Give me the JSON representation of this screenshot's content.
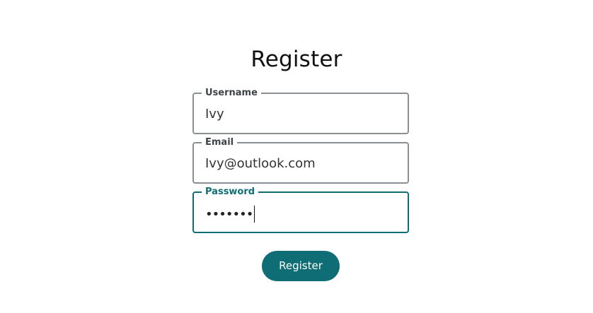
{
  "page": {
    "title": "Register"
  },
  "fields": {
    "username": {
      "label": "Username",
      "value": "Ivy"
    },
    "email": {
      "label": "Email",
      "value": "Ivy@outlook.com"
    },
    "password": {
      "label": "Password",
      "masked_value": "•••••••"
    }
  },
  "submit": {
    "label": "Register"
  },
  "colors": {
    "accent": "#0f6e75",
    "border": "#8a8f94",
    "background": "#ffffff"
  }
}
